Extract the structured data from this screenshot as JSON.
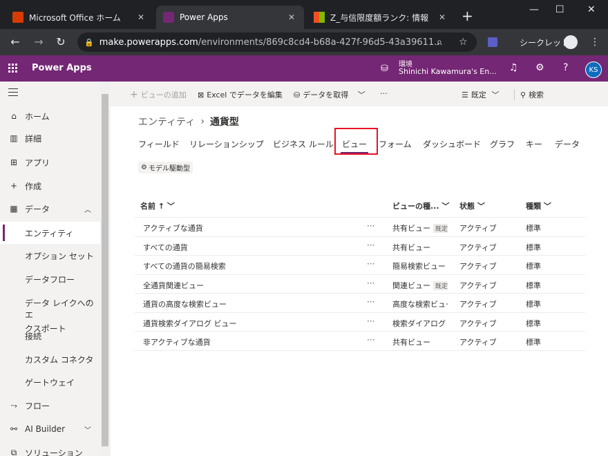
{
  "browser": {
    "tabs": [
      {
        "title": "Microsoft Office ホーム",
        "icon": "office-icon"
      },
      {
        "title": "Power Apps",
        "icon": "powerapps-icon"
      },
      {
        "title": "Z_与信限度額ランク: 情報（全",
        "icon": "windows-icon"
      }
    ],
    "url_host": "make.powerapps.com",
    "url_path": "/environments/869c8cd4-b68a-427f-96d5-43a39611...",
    "incognito_label": "シークレット"
  },
  "header": {
    "app_name": "Power Apps",
    "env_label": "環境",
    "env_name": "Shinichi Kawamura's En...",
    "avatar": "KS"
  },
  "sidebar": {
    "items": [
      {
        "label": "ホーム",
        "icon": "home-icon"
      },
      {
        "label": "詳細",
        "icon": "book-icon"
      },
      {
        "label": "アプリ",
        "icon": "apps-icon"
      },
      {
        "label": "作成",
        "icon": "plus-icon"
      },
      {
        "label": "データ",
        "icon": "table-icon"
      },
      {
        "label": "エンティティ"
      },
      {
        "label": "オプション セット"
      },
      {
        "label": "データフロー"
      },
      {
        "label": "データ レイクへのエ"
      },
      {
        "label": "クスポート"
      },
      {
        "label": "接続"
      },
      {
        "label": "カスタム コネクタ"
      },
      {
        "label": "ゲートウェイ"
      },
      {
        "label": "フロー",
        "icon": "flow-icon"
      },
      {
        "label": "AI Builder",
        "icon": "ai-icon"
      },
      {
        "label": "ソリューション",
        "icon": "solution-icon"
      }
    ]
  },
  "commandbar": {
    "add_view": "ビューの追加",
    "edit_excel": "Excel でデータを編集",
    "get_data": "データを取得",
    "more": "···",
    "settings": "既定",
    "search": "検索"
  },
  "breadcrumb": {
    "parent": "エンティティ",
    "current": "通貨型"
  },
  "tabs": [
    "フィールド",
    "リレーションシップ",
    "ビジネス ルール",
    "ビュー",
    "フォーム",
    "ダッシュボード",
    "グラフ",
    "キー",
    "データ"
  ],
  "badge": "モデル駆動型",
  "grid": {
    "headers": {
      "name": "名前 ↑",
      "view_type": "ビューの種...",
      "status": "状態",
      "type": "種類"
    },
    "rows": [
      {
        "name": "アクティブな通貨",
        "view_type": "共有ビュー",
        "default": "既定",
        "status": "アクティブ",
        "type": "標準"
      },
      {
        "name": "すべての通貨",
        "view_type": "共有ビュー",
        "default": "",
        "status": "アクティブ",
        "type": "標準"
      },
      {
        "name": "すべての通貨の簡易検索",
        "view_type": "簡易検索ビュー",
        "default": "",
        "status": "アクティブ",
        "type": "標準"
      },
      {
        "name": "全通貨関連ビュー",
        "view_type": "関連ビュー",
        "default": "既定",
        "status": "アクティブ",
        "type": "標準"
      },
      {
        "name": "通貨の高度な検索ビュー",
        "view_type": "高度な検索ビュー",
        "default": "",
        "status": "アクティブ",
        "type": "標準"
      },
      {
        "name": "通貨検索ダイアログ ビュー",
        "view_type": "検索ダイアログ",
        "default": "",
        "status": "アクティブ",
        "type": "標準"
      },
      {
        "name": "非アクティブな通貨",
        "view_type": "共有ビュー",
        "default": "",
        "status": "アクティブ",
        "type": "標準"
      }
    ],
    "row_more": "···"
  }
}
